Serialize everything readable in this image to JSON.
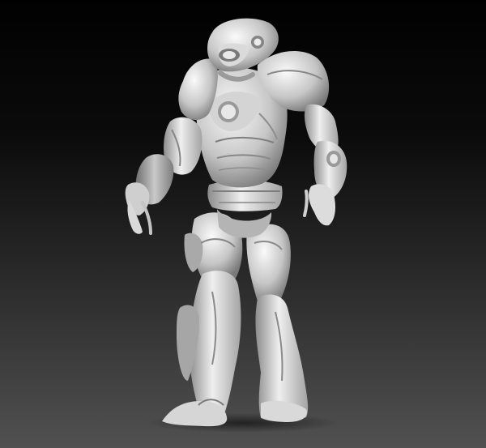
{
  "scene": {
    "subject": "robot-sculpt",
    "material": "grey-clay",
    "colors": {
      "background_top": "#010101",
      "background_bottom": "#515151",
      "clay_light": "#f1f1f1",
      "clay_mid": "#bdbdbd",
      "clay_dark": "#6e6e6e"
    }
  }
}
